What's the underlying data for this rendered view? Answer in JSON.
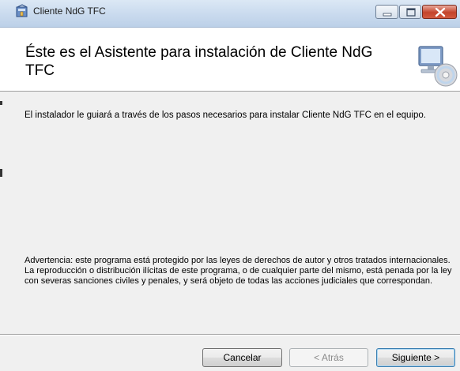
{
  "window": {
    "title": "Cliente NdG TFC",
    "controls": {
      "minimize": "minimize",
      "maximize": "maximize",
      "close": "close"
    }
  },
  "header": {
    "title": "Éste es el Asistente para instalación de Cliente NdG TFC",
    "icon": "computer-disc-icon"
  },
  "body": {
    "intro": "El instalador le guiará a través de los pasos necesarios para instalar Cliente NdG TFC en el equipo.",
    "warning": "Advertencia: este programa está protegido por las leyes de derechos de autor y otros tratados internacionales. La reproducción o distribución ilícitas de este programa, o de cualquier parte del mismo, está penada por la ley con severas sanciones civiles y penales, y será objeto de todas las acciones judiciales que correspondan."
  },
  "buttons": {
    "cancel": "Cancelar",
    "back": "< Atrás",
    "next": "Siguiente >"
  },
  "colors": {
    "titlebar": "#c9daee",
    "close_button": "#c4442b",
    "body_bg": "#f0f0f0",
    "default_button_border": "#3c7fb1"
  }
}
